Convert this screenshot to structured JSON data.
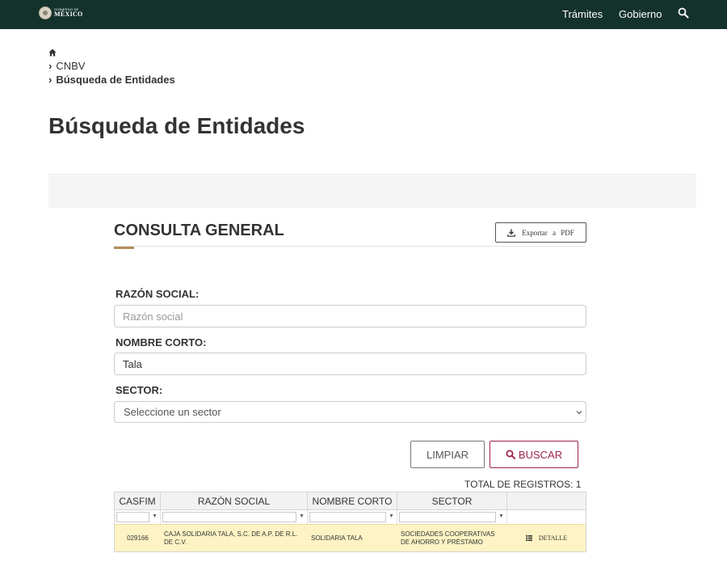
{
  "navbar": {
    "logo_small": "GOBIERNO DE",
    "logo_big": "MÉXICO",
    "links": [
      "Trámites",
      "Gobierno"
    ],
    "search_icon": "search-icon",
    "background": "#13322b"
  },
  "breadcrumb": {
    "home_icon": "home-icon",
    "items": [
      "CNBV",
      "Búsqueda de Entidades"
    ]
  },
  "page": {
    "title": "Búsqueda de Entidades"
  },
  "consulta": {
    "title": "CONSULTA GENERAL",
    "export_label": "Exportar a PDF",
    "accent_color": "#b38e5d"
  },
  "form": {
    "razon_social": {
      "label": "RAZÓN SOCIAL:",
      "placeholder": "Razón social",
      "value": ""
    },
    "nombre_corto": {
      "label": "NOMBRE CORTO:",
      "placeholder": "",
      "value": "Tala"
    },
    "sector": {
      "label": "SECTOR:",
      "selected": "Seleccione un sector"
    },
    "limpiar_label": "LIMPIAR",
    "buscar_label": "BUSCAR",
    "buscar_color": "#9d2449"
  },
  "results": {
    "total_label": "TOTAL DE REGISTROS: 1",
    "columns": [
      "CASFIM",
      "RAZÓN SOCIAL",
      "NOMBRE CORTO",
      "SECTOR",
      ""
    ],
    "rows": [
      {
        "casfim": "029166",
        "razon_social": "CAJA SOLIDARIA TALA, S.C. DE A.P. DE R.L. DE C.V.",
        "nombre_corto": "SOLIDARIA TALA",
        "sector": "SOCIEDADES COOPERATIVAS DE AHORRO Y PRÉSTAMO",
        "action": "DETALLE"
      }
    ],
    "highlight_color": "#fdf3c4"
  }
}
